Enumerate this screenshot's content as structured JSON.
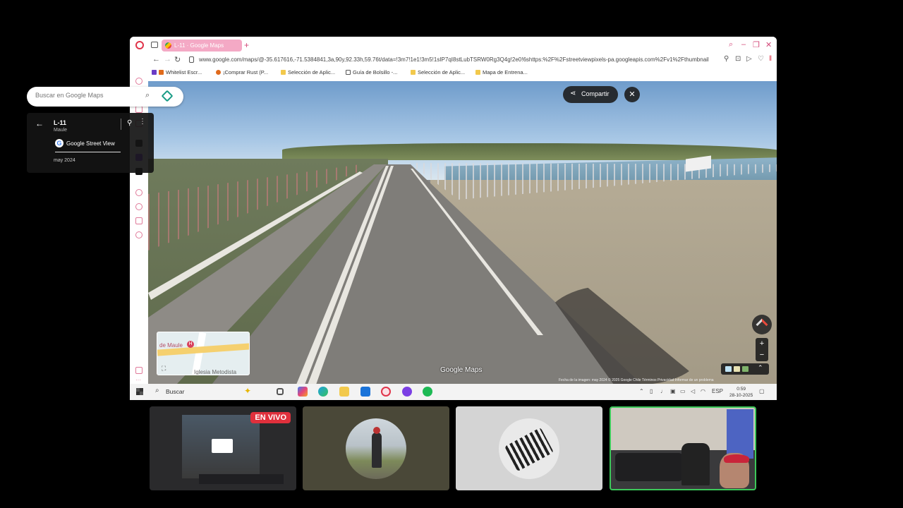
{
  "browser": {
    "tab_title": "L-11 · Google Maps",
    "url": "www.google.com/maps/@-35.617616,-71.5384841,3a,90y,92.33h,59.76t/data=!3m7!1e1!3m5!1sIP7qI8stLubTSRW0Rg3Q4g!2e0!6shttps:%2F%2Fstreetviewpixels-pa.googleapis.com%2Fv1%2Fthumbnail",
    "bookmarks": [
      {
        "label": "Whitelist Escr...",
        "color": "#6a3cc6"
      },
      {
        "label": "¡Comprar Rust (P...",
        "color": "#e06a1c"
      },
      {
        "label": "Selección de Aplic...",
        "color": "#f2c94c"
      },
      {
        "label": "Guía de Bolsillo -...",
        "color": "#555555"
      },
      {
        "label": "Selección de Aplic...",
        "color": "#f2c94c"
      },
      {
        "label": "Mapa de Entrena...",
        "color": "#f2c94c"
      }
    ]
  },
  "maps": {
    "search_placeholder": "Buscar en Google Maps",
    "info_card": {
      "title": "L-11",
      "subtitle": "Maule",
      "provider": "Google Street View",
      "date": "may 2024"
    },
    "share_label": "Compartir",
    "close_icon": "close-icon",
    "minimap": {
      "place_label": "de Maule",
      "marker_letter": "H",
      "poi_label": "Iglesia Metodista"
    },
    "watermark": "Google Maps",
    "footer": "Fecha de la imagen: may 2024   © 2025 Google   Chile   Términos   Privacidad   Informar de un problema",
    "zoom_in": "+",
    "zoom_out": "−"
  },
  "taskbar": {
    "search_label": "Buscar",
    "lang": "ESP",
    "time": "0:59",
    "date": "28-10-2025"
  },
  "stream": {
    "live_label": "EN VIVO"
  },
  "colors": {
    "accent_pink": "#e0344a",
    "live_red": "#e0303c",
    "active_tile_border": "#3cc85a"
  }
}
